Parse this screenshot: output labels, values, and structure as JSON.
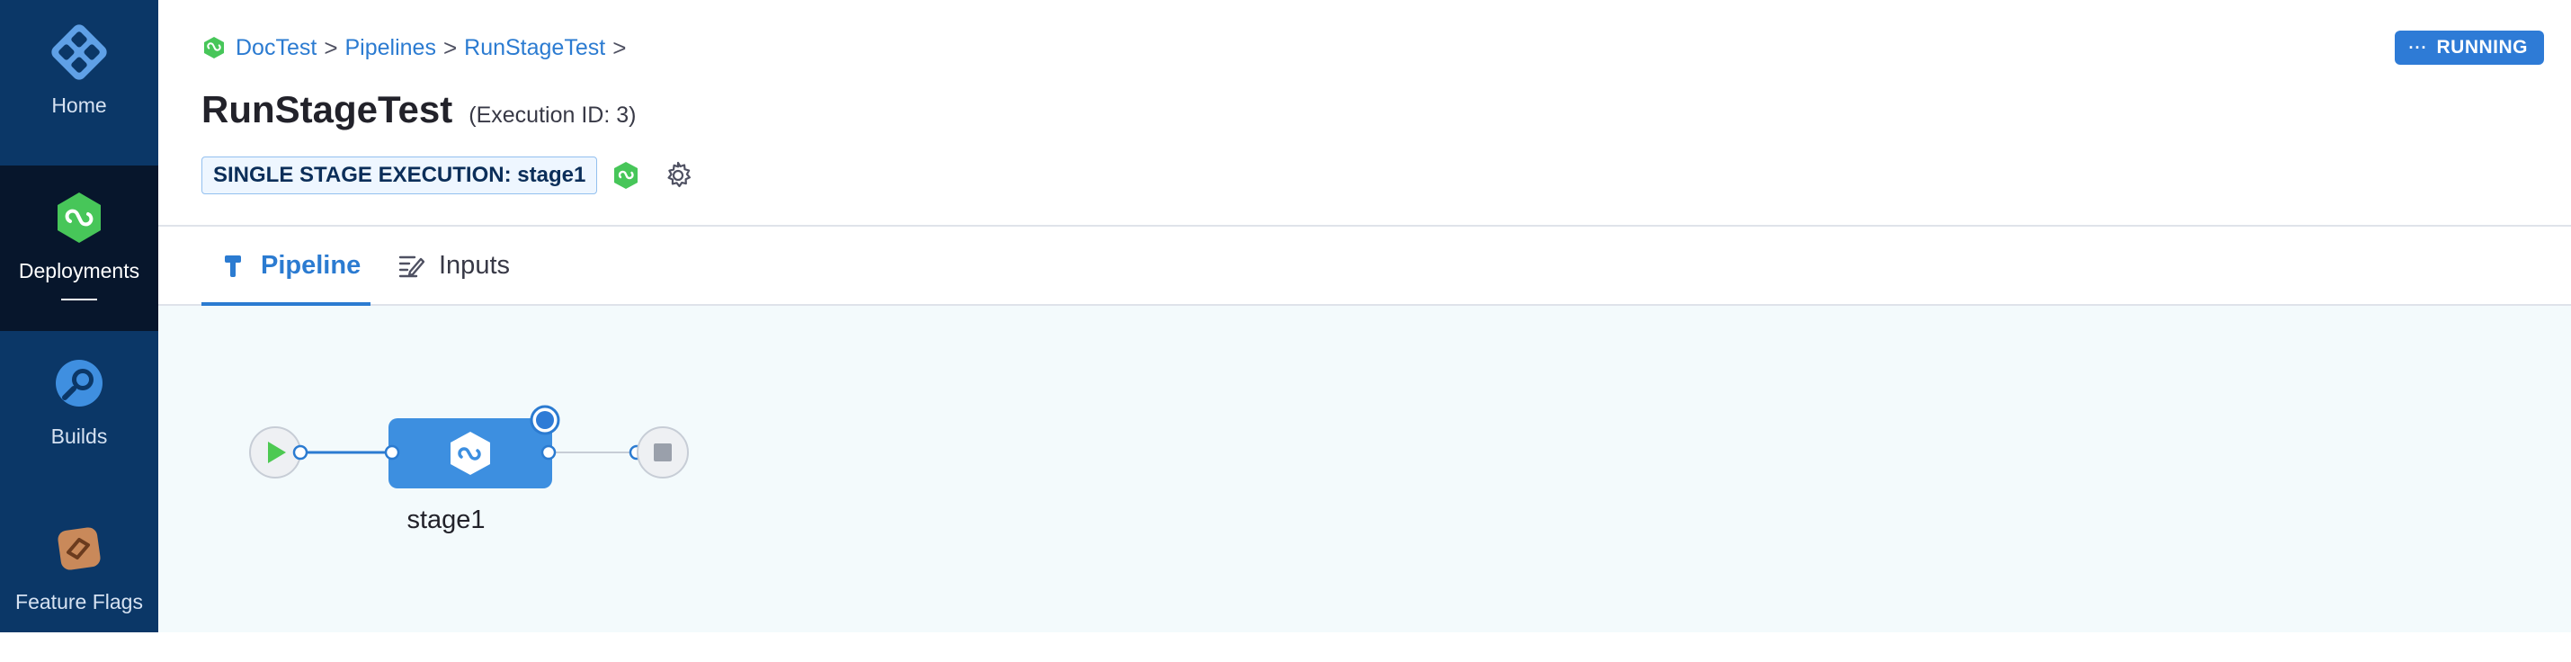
{
  "nav": {
    "items": [
      {
        "label": "Home",
        "icon": "home-icon"
      },
      {
        "label": "Deployments",
        "icon": "deployments-icon",
        "active": true
      },
      {
        "label": "Builds",
        "icon": "builds-icon"
      },
      {
        "label": "Feature Flags",
        "icon": "feature-flags-icon"
      }
    ]
  },
  "breadcrumb": {
    "items": [
      "DocTest",
      "Pipelines",
      "RunStageTest"
    ],
    "separator": ">"
  },
  "status": {
    "dots": "···",
    "label": "RUNNING",
    "color": "#2e7bd6"
  },
  "header": {
    "title": "RunStageTest",
    "execution_id": "(Execution ID: 3)",
    "tag": "SINGLE STAGE EXECUTION: stage1"
  },
  "tabs": [
    {
      "label": "Pipeline",
      "icon": "pipeline-icon",
      "active": true
    },
    {
      "label": "Inputs",
      "icon": "inputs-icon"
    }
  ],
  "pipeline": {
    "stages": [
      {
        "name": "stage1",
        "status": "running"
      }
    ],
    "start_icon": "play-icon",
    "end_icon": "stop-icon"
  },
  "colors": {
    "accent": "#2b7bd1",
    "nav_bg": "#0b3767",
    "nav_active_bg": "#07162c",
    "canvas_bg": "#f3fafc",
    "success_green": "#4dc952",
    "stage_blue": "#3d8fe0"
  }
}
